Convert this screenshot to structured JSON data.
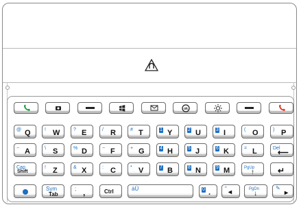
{
  "colors": {
    "outline": "#888888",
    "accent_blue": "#1e6fc1",
    "call_green": "#1a9a3a",
    "end_red": "#e2301c",
    "key_shade": "#d4d4d4"
  },
  "icons": {
    "hinge": "open-lock-triangle-icon",
    "top_row": [
      "call-send-icon",
      "camera-icon",
      "dash-icon",
      "windows-start-icon",
      "envelope-icon",
      "ok-icon",
      "brightness-icon",
      "dash-icon",
      "call-end-icon"
    ]
  },
  "rows": {
    "r1": [
      {
        "m": "Q",
        "s": "@"
      },
      {
        "m": "W",
        "s": "!"
      },
      {
        "m": "E",
        "s": "?"
      },
      {
        "m": "R",
        "s": "/"
      },
      {
        "m": "T",
        "s": "#"
      },
      {
        "m": "Y",
        "s": "1"
      },
      {
        "m": "U",
        "s": "2"
      },
      {
        "m": "I",
        "s": "3"
      },
      {
        "m": "O",
        "s": "("
      },
      {
        "m": "P",
        "s": ")"
      }
    ],
    "r2": [
      {
        "m": "A",
        "s": "−"
      },
      {
        "m": "S",
        "s": "\\"
      },
      {
        "m": "D",
        "s": "%"
      },
      {
        "m": "F",
        "s": "−"
      },
      {
        "m": "G",
        "s": "+"
      },
      {
        "m": "H",
        "s": "4"
      },
      {
        "m": "J",
        "s": "5"
      },
      {
        "m": "K",
        "s": "6"
      },
      {
        "m": "L",
        "s": "="
      },
      {
        "m": "",
        "s": "Del"
      }
    ],
    "r3": [
      {
        "m": "Shift",
        "s": "Cap"
      },
      {
        "m": "Z",
        "s": "!"
      },
      {
        "m": "X",
        "s": "&"
      },
      {
        "m": "C",
        "s": ":"
      },
      {
        "m": "V",
        "s": "*"
      },
      {
        "m": "B",
        "s": "7"
      },
      {
        "m": "N",
        "s": "8"
      },
      {
        "m": "M",
        "s": "9"
      },
      {
        "m": "",
        "s": "PgUp"
      },
      {
        "m": "",
        "s": ""
      }
    ],
    "r4": {
      "sym_top": "Sym",
      "sym_bottom": "Tab",
      "semi": ",",
      "semi_top": ";",
      "ctrl": "Ctrl",
      "space_label": "àÜ",
      "zero": "0",
      "dot": ".",
      "quote": "\"",
      "pgdn": "PgDn"
    }
  }
}
